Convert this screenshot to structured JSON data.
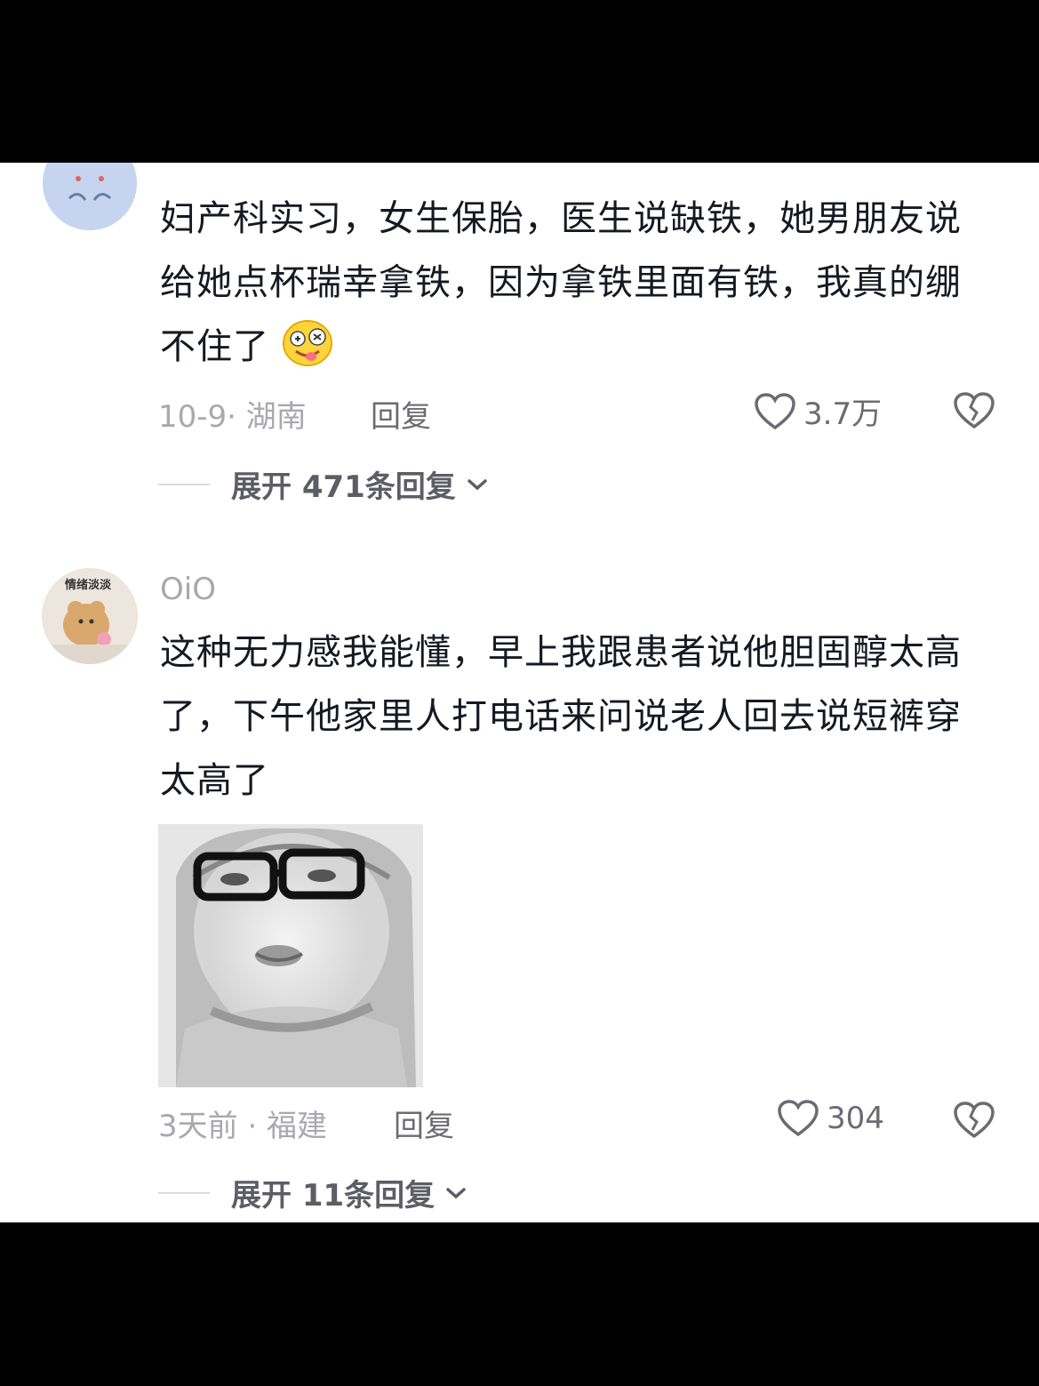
{
  "comment1": {
    "text": "妇产科实习，女生保胎，医生说缺铁，她男朋友说给她点杯瑞幸拿铁，因为拿铁里面有铁，我真的绷不住了",
    "emoji_icon": "drooling-dizzy-face-emoji",
    "date_location": "10-9· 湖南",
    "reply_label": "回复",
    "likes": "3.7万",
    "expand_label": "展开 471条回复"
  },
  "comment2": {
    "username": "OiO",
    "avatar_text": "情绪淡淡",
    "text": "这种无力感我能懂，早上我跟患者说他胆固醇太高了，下午他家里人打电话来问说老人回去说短裤穿太高了",
    "date_location": "3天前 · 福建",
    "reply_label": "回复",
    "likes": "304",
    "expand_label": "展开 11条回复"
  },
  "colors": {
    "text": "#161823",
    "meta": "#a8a8b0",
    "background": "#ffffff",
    "letterbox": "#000000"
  }
}
